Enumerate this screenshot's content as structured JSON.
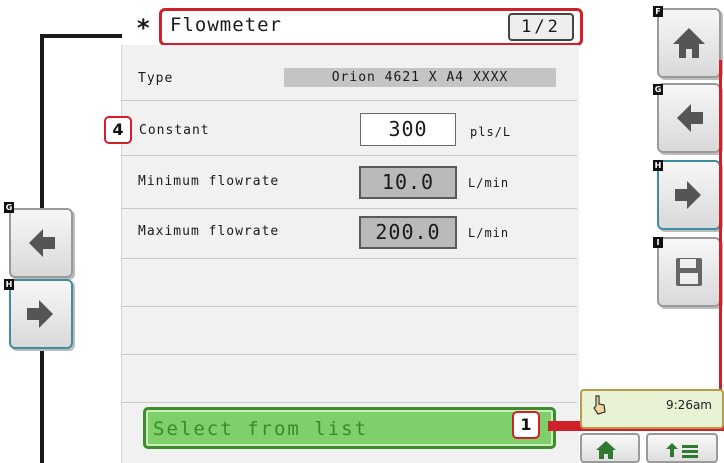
{
  "header": {
    "star": "*",
    "title": "Flowmeter",
    "page": "1/2"
  },
  "fields": {
    "type_label": "Type",
    "type_value": "Orion 4621 X A4 XXXX",
    "constant_label": "Constant",
    "constant_value": "300",
    "constant_unit": "pls/L",
    "min_label": "Minimum flowrate",
    "min_value": "10.0",
    "min_unit": "L/min",
    "max_label": "Maximum flowrate",
    "max_value": "200.0",
    "max_unit": "L/min"
  },
  "select_button": "Select from list",
  "callouts": {
    "four": "4",
    "one": "1"
  },
  "tags": {
    "f": "F",
    "g": "G",
    "h": "H",
    "i": "I",
    "g_left": "G",
    "h_left": "H"
  },
  "status": {
    "time": "9:26am"
  },
  "colors": {
    "callout_red": "#d0202b",
    "select_green": "#7fd06a",
    "select_text": "#3a8a29",
    "arrow_gray": "#555555"
  },
  "icons": {
    "home": "home-icon",
    "back": "arrow-left-icon",
    "forward": "arrow-right-icon",
    "save": "floppy-disk-icon",
    "hand": "hand-pointer-icon",
    "menu": "menu-arrow-icon"
  }
}
